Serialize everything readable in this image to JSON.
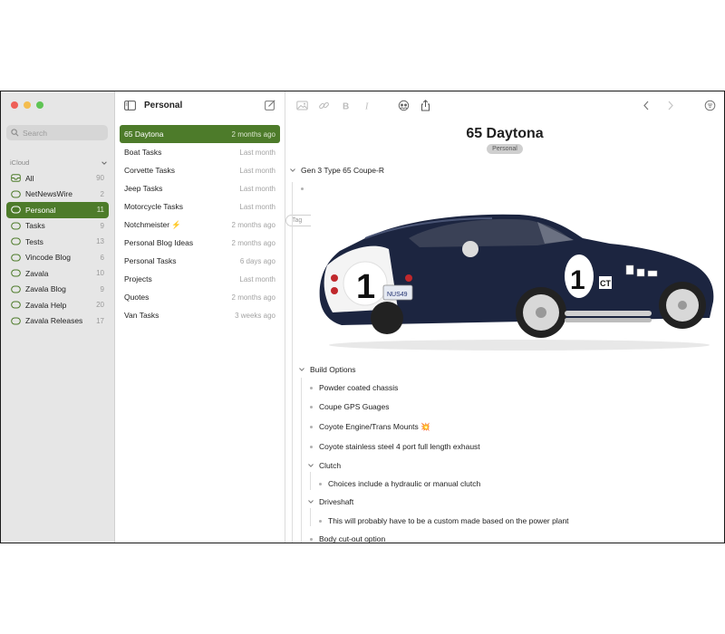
{
  "sidebar": {
    "search_placeholder": "Search",
    "section": "iCloud",
    "items": [
      {
        "label": "All",
        "count": "90"
      },
      {
        "label": "NetNewsWire",
        "count": "2"
      },
      {
        "label": "Personal",
        "count": "11"
      },
      {
        "label": "Tasks",
        "count": "9"
      },
      {
        "label": "Tests",
        "count": "13"
      },
      {
        "label": "Vincode Blog",
        "count": "6"
      },
      {
        "label": "Zavala",
        "count": "10"
      },
      {
        "label": "Zavala Blog",
        "count": "9"
      },
      {
        "label": "Zavala Help",
        "count": "20"
      },
      {
        "label": "Zavala Releases",
        "count": "17"
      }
    ],
    "selected_index": 2
  },
  "list": {
    "title": "Personal",
    "rows": [
      {
        "title": "65 Daytona",
        "date": "2 months ago"
      },
      {
        "title": "Boat Tasks",
        "date": "Last month"
      },
      {
        "title": "Corvette Tasks",
        "date": "Last month"
      },
      {
        "title": "Jeep Tasks",
        "date": "Last month"
      },
      {
        "title": "Motorcycle Tasks",
        "date": "Last month"
      },
      {
        "title": "Notchmeister ⚡️",
        "date": "2 months ago"
      },
      {
        "title": "Personal Blog Ideas",
        "date": "2 months ago"
      },
      {
        "title": "Personal Tasks",
        "date": "6 days ago"
      },
      {
        "title": "Projects",
        "date": "Last month"
      },
      {
        "title": "Quotes",
        "date": "2 months ago"
      },
      {
        "title": "Van Tasks",
        "date": "3 weeks ago"
      }
    ],
    "selected_index": 0
  },
  "editor": {
    "title": "65 Daytona",
    "tags": [
      "Personal",
      "Tag"
    ],
    "outline": {
      "heading": "Gen 3 Type 65 Coupe-R",
      "build_options": "Build Options",
      "items": [
        "Powder coated chassis",
        "Coupe GPS Guages",
        "Coyote Engine/Trans Mounts 💥",
        "Coyote stainless steel 4 port full length exhaust",
        "Clutch",
        "Choices include a hydraulic or manual clutch",
        "Driveshaft",
        "This will probably have to be a custom made based on the power plant",
        "Body cut-out option"
      ]
    },
    "car_image": {
      "number": "1",
      "plate": "NUS49",
      "badge": "CT",
      "flag": "USA"
    }
  },
  "colors": {
    "accent": "#4d7b2a",
    "sidebar_bg": "#e6e6e6",
    "car_body": "#1c2540"
  }
}
